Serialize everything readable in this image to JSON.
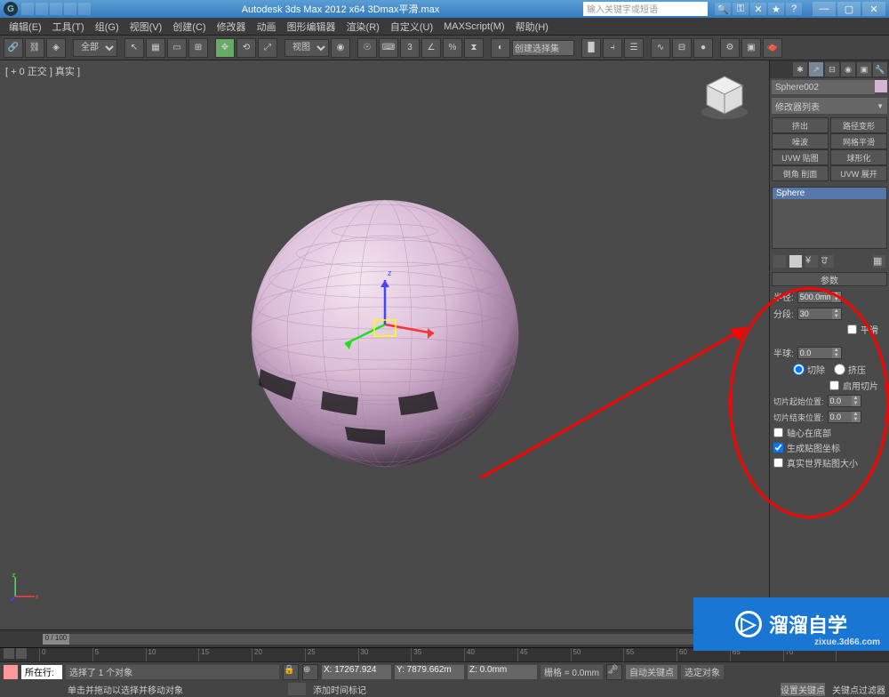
{
  "titlebar": {
    "title": "Autodesk 3ds Max 2012 x64    3Dmax平滑.max",
    "search_placeholder": "输入关键字或短语"
  },
  "menu": [
    "编辑(E)",
    "工具(T)",
    "组(G)",
    "视图(V)",
    "创建(C)",
    "修改器",
    "动画",
    "图形编辑器",
    "渲染(R)",
    "自定义(U)",
    "MAXScript(M)",
    "帮助(H)"
  ],
  "toolbar": {
    "scope": "全部",
    "view_dd": "视图",
    "sel_set": "创建选择集"
  },
  "viewport": {
    "label": "[ + 0 正交 ] 真实 ]"
  },
  "rpanel": {
    "obj_name": "Sphere002",
    "modlist_label": "修改器列表",
    "modifiers": [
      [
        "挤出",
        "路径变形"
      ],
      [
        "噪波",
        "网格平滑"
      ],
      [
        "UVW 贴图",
        "球形化"
      ],
      [
        "倒角 削面",
        "UVW 展开"
      ]
    ],
    "stack_item": "Sphere",
    "rollout": "参数",
    "params": {
      "radius_label": "半径:",
      "radius": "500.0mm",
      "segs_label": "分段:",
      "segs": "30",
      "smooth": "平滑",
      "hemi_label": "半球:",
      "hemi": "0.0",
      "chop": "切除",
      "squash": "挤压",
      "slice_on": "启用切片",
      "slice_from_label": "切片起始位置:",
      "slice_from": "0.0",
      "slice_to_label": "切片结束位置:",
      "slice_to": "0.0",
      "base_pivot": "轴心在底部",
      "gen_uv": "生成贴图坐标",
      "real_world": "真实世界贴图大小"
    }
  },
  "timeline": {
    "range": "0 / 100"
  },
  "status": {
    "sel_hint": "选择了 1 个对象",
    "x": "X: 17267.924",
    "y": "Y: 7879.662m",
    "z": "Z: 0.0mm",
    "grid": "栅格 = 0.0mm",
    "auto_key": "自动关键点",
    "sel_set2": "选定对象",
    "set_key": "设置关键点",
    "filter": "关键点过滤器",
    "row_label": "所在行:"
  },
  "prompt": {
    "hint": "单击并拖动以选择并移动对象",
    "add_time": "添加时间标记"
  },
  "watermark": {
    "text": "溜溜自学",
    "url": "zixue.3d66.com"
  }
}
